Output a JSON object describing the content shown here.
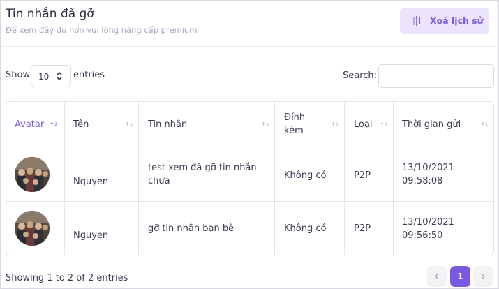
{
  "header": {
    "title": "Tin nhắn đã gỡ",
    "subtitle": "Để xem đầy đủ hơn vui lòng nâng cấp premium",
    "clear_button": "Xoá lịch sử"
  },
  "controls": {
    "show_label": "Show",
    "page_size": "10",
    "entries_label": "entries",
    "search_label": "Search:",
    "search_value": ""
  },
  "table": {
    "columns": [
      "Avatar",
      "Tên",
      "Tin nhắn",
      "Đính kèm",
      "Loại",
      "Thời gian gửi"
    ],
    "rows": [
      {
        "name": "Nguyen",
        "message": "test xem đã gỡ tin nhắn chưa",
        "attachment": "Không có",
        "type": "P2P",
        "sent_time": "13/10/2021 09:58:08"
      },
      {
        "name": "Nguyen",
        "message": "gỡ tin nhắn bạn bè",
        "attachment": "Không có",
        "type": "P2P",
        "sent_time": "13/10/2021 09:56:50"
      }
    ]
  },
  "footer": {
    "summary": "Showing 1 to 2 of 2 entries",
    "current_page": "1"
  },
  "colors": {
    "accent": "#7a5ae0",
    "accent_light": "#ece4fd",
    "text": "#3a3a52",
    "muted": "#a5a5bb",
    "border": "#e4e4ec"
  }
}
